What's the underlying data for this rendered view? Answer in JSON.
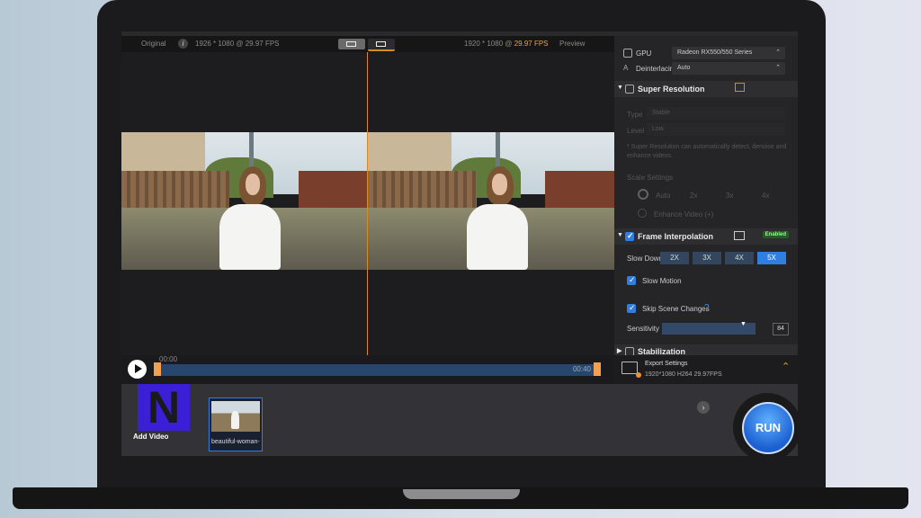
{
  "app": {
    "title_peek": ""
  },
  "preview": {
    "left_label": "Original",
    "left_meta": "1926 * 1080 @ 29.97 FPS",
    "right_meta_res": "1920 * 1080 @ ",
    "right_meta_fps": "29.97 FPS",
    "right_label": "Preview",
    "info_glyph": "i"
  },
  "timeline": {
    "start": "00:00",
    "end": "00:40"
  },
  "settings": {
    "gpu_label": "GPU",
    "gpu_value": "Radeon RX550/550 Series",
    "deinterlacing_label": "Deinterlacing",
    "deinterlacing_value": "Auto",
    "super_resolution": {
      "title": "Super Resolution",
      "type_label": "Type",
      "type_value": "Stable",
      "level_label": "Level",
      "level_value": "Low",
      "note": "* Super Resolution can automatically detect, denoise and enhance videos.",
      "scale_label": "Scale Settings",
      "scale_options": [
        "Auto",
        "2x",
        "3x",
        "4x"
      ],
      "enhance_label": "Enhance Video (+)"
    },
    "frame_interpolation": {
      "title": "Frame Interpolation",
      "badge": "Enabled",
      "slow_down_label": "Slow Down",
      "slow_down_options": [
        "2X",
        "3X",
        "4X",
        "5X"
      ],
      "slow_down_selected": "5X",
      "slow_motion_label": "Slow Motion",
      "skip_scene_label": "Skip Scene Changes",
      "help_glyph": "?",
      "sensitivity_label": "Sensitivity",
      "sensitivity_value": "84"
    },
    "stabilization_title": "Stabilization"
  },
  "export": {
    "title": "Export Settings",
    "detail": "1920*1080   H264   29.97FPS"
  },
  "bottom": {
    "logo_letter": "N",
    "add_video_label": "Add Video",
    "thumb_name": "beautiful-woman-",
    "next_glyph": "›",
    "run_label": "RUN"
  }
}
